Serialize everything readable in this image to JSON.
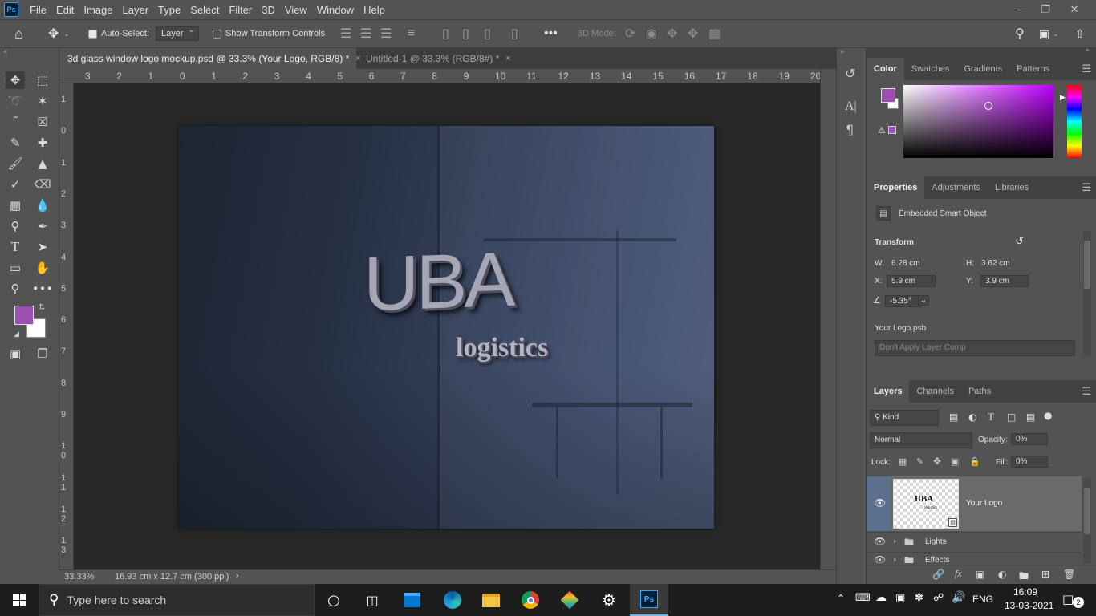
{
  "menubar": {
    "app_badge": "Ps",
    "items": [
      "File",
      "Edit",
      "Image",
      "Layer",
      "Type",
      "Select",
      "Filter",
      "3D",
      "View",
      "Window",
      "Help"
    ]
  },
  "options": {
    "auto_select_label": "Auto-Select:",
    "auto_select_target": "Layer",
    "show_transform_label": "Show Transform Controls",
    "mode_label": "3D Mode:"
  },
  "tabs": [
    {
      "label": "3d glass window logo mockup.psd @ 33.3% (Your Logo, RGB/8) *",
      "close": "×"
    },
    {
      "label": "Untitled-1 @ 33.3% (RGB/8#) *",
      "close": "×"
    }
  ],
  "ruler_top": [
    "3",
    "2",
    "1",
    "0",
    "1",
    "2",
    "3",
    "4",
    "5",
    "6",
    "7",
    "8",
    "9",
    "10",
    "11",
    "12",
    "13",
    "14",
    "15",
    "16",
    "17",
    "18",
    "19",
    "20"
  ],
  "ruler_left": [
    "1",
    "0",
    "1",
    "2",
    "3",
    "4",
    "5",
    "6",
    "7",
    "8",
    "9",
    "1 0",
    "1 1",
    "1 2",
    "1 3"
  ],
  "artwork": {
    "logo_main": "UBA",
    "logo_sub": "logistics"
  },
  "status": {
    "zoom": "33.33%",
    "doc_size": "16.93 cm x 12.7 cm (300 ppi)",
    "arrow": "›"
  },
  "color_panel": {
    "tabs": [
      "Color",
      "Swatches",
      "Gradients",
      "Patterns"
    ],
    "foreground": "#9b4fb3",
    "background": "#ffffff"
  },
  "properties_panel": {
    "tabs": [
      "Properties",
      "Adjustments",
      "Libraries"
    ],
    "object_type": "Embedded Smart Object",
    "section": "Transform",
    "w_label": "W:",
    "w_value": "6.28 cm",
    "h_label": "H:",
    "h_value": "3.62 cm",
    "x_label": "X:",
    "x_value": "5.9 cm",
    "y_label": "Y:",
    "y_value": "3.9 cm",
    "angle_value": "-5.35°",
    "file_name": "Your Logo.psb",
    "layer_comp": "Don't Apply Layer Comp"
  },
  "layers_panel": {
    "tabs": [
      "Layers",
      "Channels",
      "Paths"
    ],
    "filter_kind": "Kind",
    "blend_mode": "Normal",
    "opacity_label": "Opacity:",
    "opacity_value": "0%",
    "lock_label": "Lock:",
    "fill_label": "Fill:",
    "fill_value": "0%",
    "layers": [
      {
        "name": "Your Logo",
        "thumb_text": "UBA",
        "thumb_sub": "logistics",
        "selected": true
      },
      {
        "name": "Lights",
        "selected": false
      },
      {
        "name": "Effects",
        "selected": false
      }
    ]
  },
  "taskbar": {
    "search_placeholder": "Type here to search",
    "language": "ENG",
    "time": "16:09",
    "date": "13-03-2021",
    "notification_count": "2"
  }
}
